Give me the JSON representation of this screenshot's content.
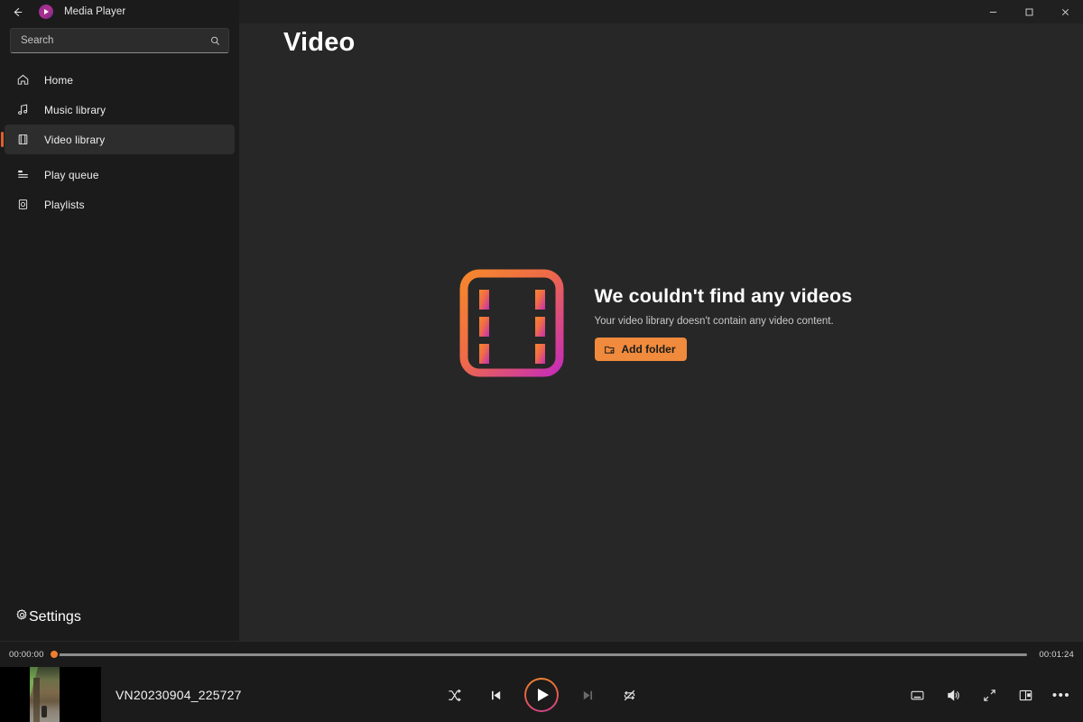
{
  "window": {
    "app_title": "Media Player",
    "back_label": "Back",
    "app_icon": "media-player-icon",
    "controls": {
      "minimize": "Minimize",
      "maximize": "Maximize",
      "close": "Close"
    }
  },
  "search": {
    "placeholder": "Search",
    "value": "",
    "icon": "search-icon"
  },
  "sidebar": {
    "items": [
      {
        "label": "Home",
        "icon": "home-icon",
        "selected": false
      },
      {
        "label": "Music library",
        "icon": "music-note-icon",
        "selected": false
      },
      {
        "label": "Video library",
        "icon": "video-frame-icon",
        "selected": true
      },
      {
        "label": "Play queue",
        "icon": "queue-list-icon",
        "selected": false
      },
      {
        "label": "Playlists",
        "icon": "playlist-icon",
        "selected": false
      }
    ],
    "settings": {
      "label": "Settings",
      "icon": "gear-icon"
    }
  },
  "main": {
    "page_title": "Video",
    "empty_state": {
      "icon": "film-strip-icon",
      "heading": "We couldn't find any videos",
      "subtext": "Your video library doesn't contain any video content.",
      "button_label": "Add folder",
      "button_icon": "add-folder-icon"
    }
  },
  "player": {
    "current_time": "00:00:00",
    "total_time": "00:01:24",
    "progress_percent": 0,
    "now_playing": {
      "title": "VN20230904_225727",
      "thumbnail": "video-thumbnail"
    },
    "transport": {
      "shuffle": "Shuffle",
      "previous": "Previous",
      "play": "Play",
      "next": "Next",
      "repeat": "Repeat off"
    },
    "right_controls": [
      {
        "label": "Subtitles",
        "icon": "captions-icon"
      },
      {
        "label": "Volume",
        "icon": "volume-icon"
      },
      {
        "label": "Full screen",
        "icon": "expand-icon"
      },
      {
        "label": "Mini player",
        "icon": "miniplayer-icon"
      },
      {
        "label": "More options",
        "icon": "ellipsis-icon"
      }
    ]
  },
  "colors": {
    "accent_orange": "#e0622a",
    "button_orange": "#f08a3c",
    "gradient_start": "#f08a35",
    "gradient_end": "#cf3f8e",
    "background": "#202020",
    "sidebar_bg": "#1b1b1b",
    "content_bg": "#272727"
  }
}
